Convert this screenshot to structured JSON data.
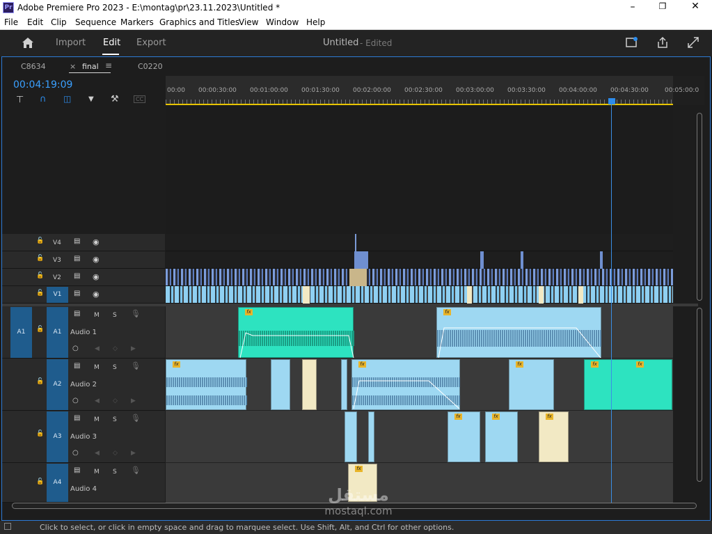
{
  "window": {
    "app_icon": "Pr",
    "title": "Adobe Premiere Pro 2023 - E:\\montag\\pr\\23.11.2023\\Untitled *",
    "controls": [
      "minimize-icon",
      "restore-icon",
      "close-icon"
    ]
  },
  "menu": [
    "File",
    "Edit",
    "Clip",
    "Sequence",
    "Markers",
    "Graphics and Titles",
    "View",
    "Window",
    "Help"
  ],
  "appbar": {
    "workspaces": [
      "Import",
      "Edit",
      "Export"
    ],
    "active": "Edit",
    "project_title": "Untitled",
    "project_status": "- Edited"
  },
  "timeline": {
    "tabs": [
      "C8634",
      "final",
      "C0220"
    ],
    "active_tab": "final",
    "timecode": "00:04:19:09",
    "ruler": [
      "00:00",
      "00:00:30:00",
      "00:01:00:00",
      "00:01:30:00",
      "00:02:00:00",
      "00:02:30:00",
      "00:03:00:00",
      "00:03:30:00",
      "00:04:00:00",
      "00:04:30:00",
      "00:05:00:0"
    ],
    "tools": [
      "insert-icon",
      "snap-magnet-icon",
      "linked-selection-icon",
      "add-marker-icon",
      "wrench-icon",
      "captions-icon"
    ],
    "playhead_time": "00:04:19:09",
    "video_tracks": [
      "V4",
      "V3",
      "V2",
      "V1"
    ],
    "audio_tracks": [
      {
        "id": "A1",
        "name": "Audio 1",
        "source": "A1"
      },
      {
        "id": "A2",
        "name": "Audio 2"
      },
      {
        "id": "A3",
        "name": "Audio 3"
      },
      {
        "id": "A4",
        "name": "Audio 4"
      }
    ],
    "track_buttons": {
      "mute": "M",
      "solo": "S"
    }
  },
  "status": "Click to select, or click in empty space and drag to marquee select. Use Shift, Alt, and Ctrl for other options.",
  "watermark": {
    "line1": "مستقل",
    "line2": "mostaql.com"
  },
  "colors": {
    "accent": "#2d8ceb",
    "timecode": "#3aa0ff",
    "video_clip": "#8ecff3",
    "audio_clip": "#9ed8f2",
    "selected_audio": "#2de3c0",
    "still_clip": "#f2e9c4",
    "track_chip": "#1f5c8d"
  }
}
